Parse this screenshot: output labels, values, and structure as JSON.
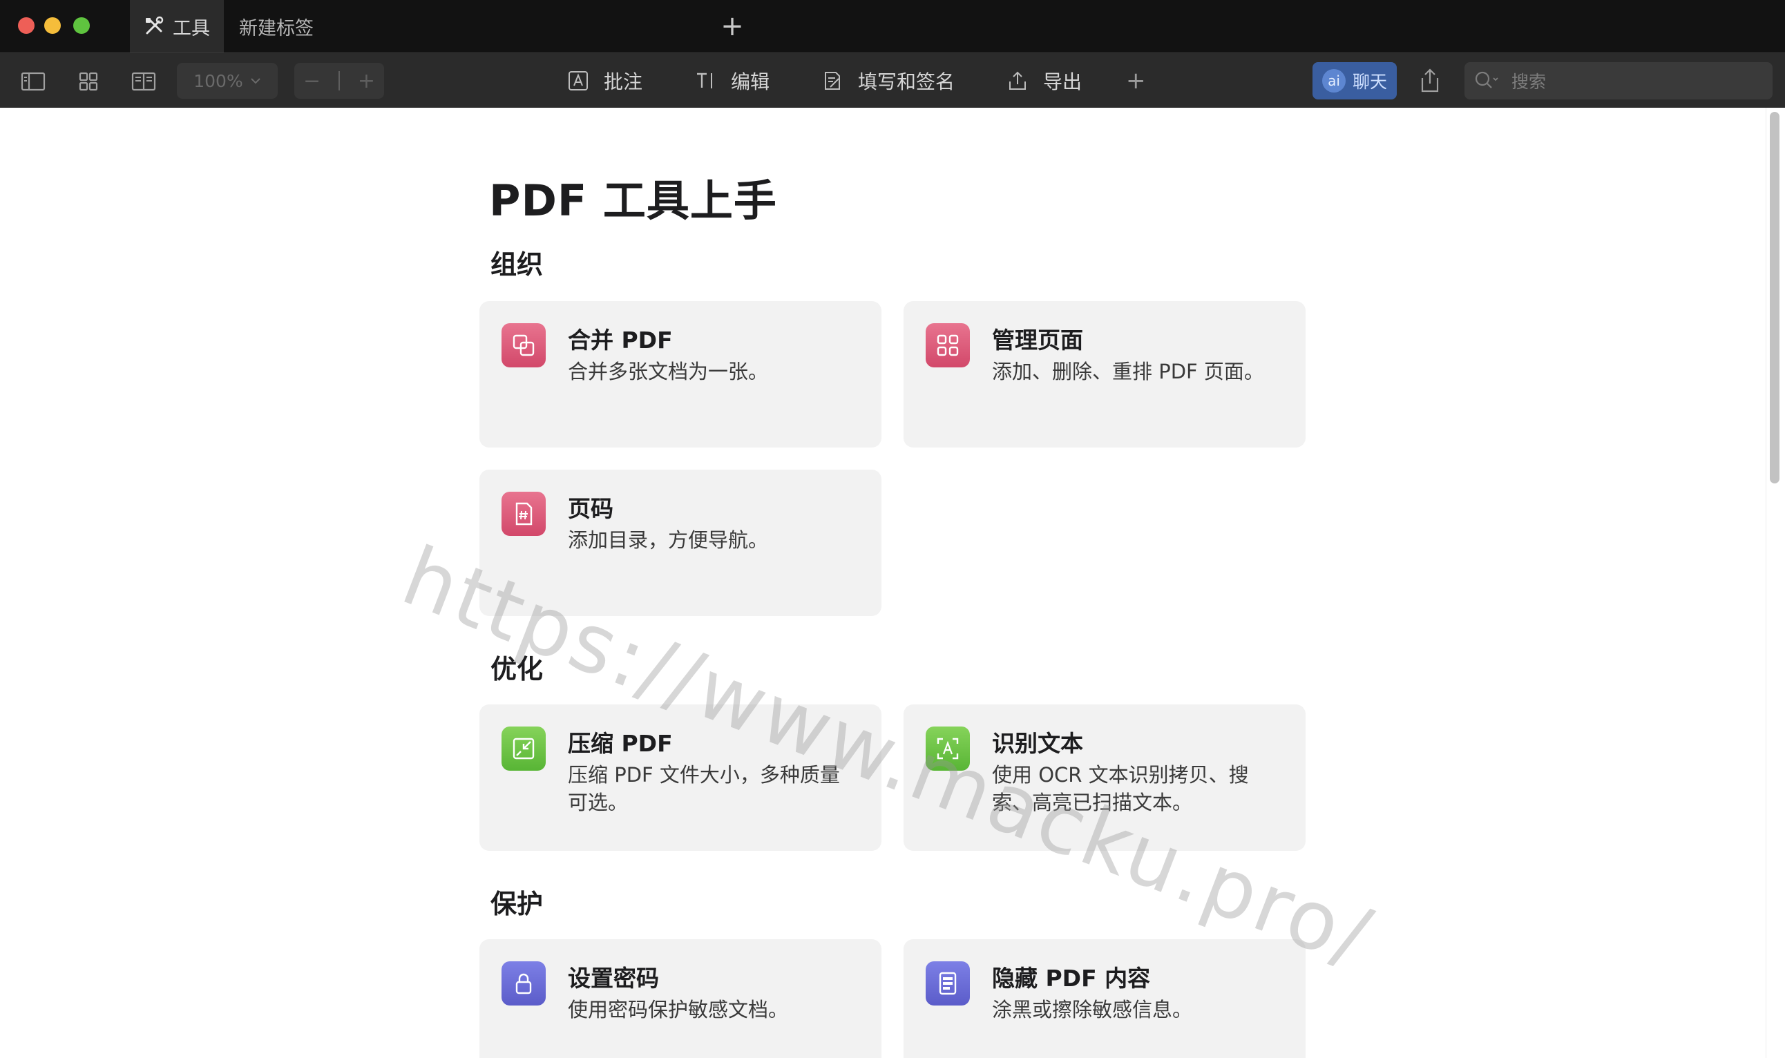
{
  "window": {
    "tabs": [
      {
        "label": "工具",
        "icon": "tools-icon",
        "active": true
      },
      {
        "label": "新建标签",
        "active": false
      }
    ]
  },
  "toolbar": {
    "zoom_value": "100%",
    "tools": [
      {
        "label": "批注",
        "icon": "annotate-icon"
      },
      {
        "label": "编辑",
        "icon": "text-edit-icon"
      },
      {
        "label": "填写和签名",
        "icon": "fill-sign-icon"
      },
      {
        "label": "导出",
        "icon": "export-icon"
      }
    ],
    "chat_label": "聊天",
    "ai_badge": "ai",
    "search_placeholder": "搜索"
  },
  "main": {
    "title": "PDF 工具上手",
    "sections": [
      {
        "title": "组织",
        "cards": [
          {
            "title": "合并 PDF",
            "desc": "合并多张文档为一张。",
            "icon": "merge-icon",
            "color": "#d94f72"
          },
          {
            "title": "管理页面",
            "desc": "添加、删除、重排 PDF 页面。",
            "icon": "grid-pages-icon",
            "color": "#d94f72"
          },
          {
            "title": "页码",
            "desc": "添加目录，方便导航。",
            "icon": "page-number-icon",
            "color": "#d94f72"
          }
        ]
      },
      {
        "title": "优化",
        "cards": [
          {
            "title": "压缩 PDF",
            "desc": "压缩 PDF 文件大小，多种质量可选。",
            "icon": "compress-icon",
            "color": "#62bb3a"
          },
          {
            "title": "识别文本",
            "desc": "使用 OCR 文本识别拷贝、搜索、高亮已扫描文本。",
            "icon": "ocr-icon",
            "color": "#62bb3a"
          }
        ]
      },
      {
        "title": "保护",
        "cards": [
          {
            "title": "设置密码",
            "desc": "使用密码保护敏感文档。",
            "icon": "lock-icon",
            "color": "#6464d2"
          },
          {
            "title": "隐藏 PDF 内容",
            "desc": "涂黑或擦除敏感信息。",
            "icon": "redact-icon",
            "color": "#6464d2"
          }
        ]
      }
    ]
  },
  "watermark": "https://www.macku.pro/"
}
